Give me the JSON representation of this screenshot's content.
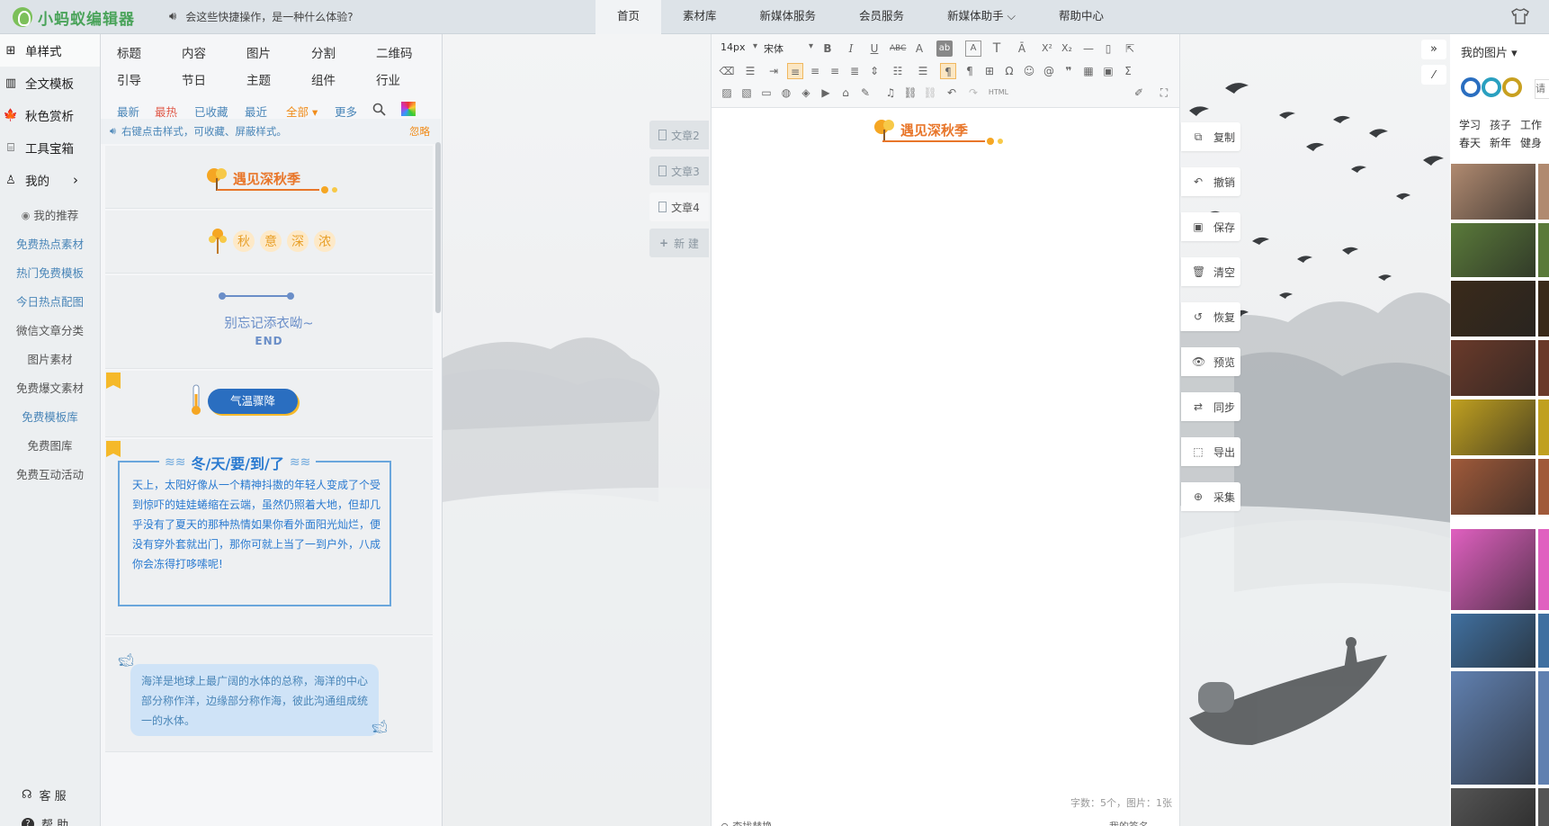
{
  "topbar": {
    "logo_text": "小蚂蚁编辑器",
    "notice": "会这些快捷操作，是一种什么体验?",
    "nav": [
      {
        "label": "首页",
        "active": true
      },
      {
        "label": "素材库"
      },
      {
        "label": "新媒体服务"
      },
      {
        "label": "会员服务"
      },
      {
        "label": "新媒体助手 ⌵"
      },
      {
        "label": "帮助中心"
      }
    ]
  },
  "sidebar": {
    "main": [
      {
        "label": "单样式",
        "icon": "grid-icon",
        "glyph": "⊞"
      },
      {
        "label": "全文模板",
        "icon": "template-icon",
        "glyph": "▥"
      },
      {
        "label": "秋色赏析",
        "icon": "maple-leaf-icon",
        "glyph": "🍁"
      },
      {
        "label": "工具宝箱",
        "icon": "toolbox-icon",
        "glyph": "⌸"
      },
      {
        "label": "我的",
        "icon": "user-icon",
        "glyph": "♙",
        "chevron": "›"
      }
    ],
    "sub": [
      {
        "label": "我的推荐",
        "icon": "eye-icon"
      },
      {
        "label": "免费热点素材",
        "link": true
      },
      {
        "label": "热门免费模板",
        "link": true
      },
      {
        "label": "今日热点配图",
        "link": true
      },
      {
        "label": "微信文章分类"
      },
      {
        "label": "图片素材"
      },
      {
        "label": "免费爆文素材"
      },
      {
        "label": "免费模板库",
        "link": true
      },
      {
        "label": "免费图库"
      },
      {
        "label": "免费互动活动"
      }
    ],
    "service": "客 服",
    "help": "帮 助"
  },
  "style_panel": {
    "categories_row1": [
      "标题",
      "内容",
      "图片",
      "分割",
      "二维码"
    ],
    "categories_row2": [
      "引导",
      "节日",
      "主题",
      "组件",
      "行业"
    ],
    "filters": [
      {
        "label": "最新",
        "color": "#4a86b8"
      },
      {
        "label": "最热",
        "color": "#e05a4a"
      },
      {
        "label": "已收藏",
        "color": "#4a86b8"
      },
      {
        "label": "最近",
        "color": "#4a86b8"
      },
      {
        "label": "全部 ▾",
        "color": "#f08c1a"
      },
      {
        "label": "更多",
        "color": "#4a86b8"
      }
    ],
    "tip": "右键点击样式，可收藏、屏蔽样式。",
    "tip_ignore": "忽略",
    "cards": {
      "autumn_title": "遇见深秋季",
      "autumn_chars": [
        "秋",
        "意",
        "深",
        "浓"
      ],
      "remember": "别忘记添衣呦~",
      "end": "END",
      "temp_button": "气温骤降",
      "winter_title": "冬/天/要/到/了",
      "winter_body": "天上，太阳好像从一个精神抖擞的年轻人变成了个受到惊吓的娃娃蜷缩在云端，虽然仍照着大地，但却几乎没有了夏天的那种热情如果你看外面阳光灿烂，便没有穿外套就出门，那你可就上当了一到户外，八成你会冻得打哆嗦呢!",
      "ocean_body": "海洋是地球上最广阔的水体的总称，海洋的中心部分称作洋，边缘部分称作海，彼此沟通组成统一的水体。"
    }
  },
  "article_tabs": [
    {
      "label": "文章2"
    },
    {
      "label": "文章3"
    },
    {
      "label": "文章4",
      "active": true
    },
    {
      "label": "新 建"
    }
  ],
  "editor": {
    "font_size": "14px",
    "font_family": "宋体",
    "content_title": "遇见深秋季",
    "status": "字数：5个，图片：1张",
    "footer_left": "查找替换",
    "footer_right": "我的签名"
  },
  "right_tools": [
    {
      "label": "复制",
      "icon": "copy-icon",
      "glyph": "⧉"
    },
    {
      "label": "撤销",
      "icon": "undo-icon",
      "glyph": "↶"
    },
    {
      "label": "保存",
      "icon": "save-icon",
      "glyph": "▣"
    },
    {
      "label": "清空",
      "icon": "trash-icon",
      "glyph": "🗑"
    },
    {
      "label": "恢复",
      "icon": "restore-icon",
      "glyph": "↺"
    },
    {
      "label": "预览",
      "icon": "eye-icon",
      "glyph": "👁"
    },
    {
      "label": "同步",
      "icon": "sync-icon",
      "glyph": "⇄"
    },
    {
      "label": "导出",
      "icon": "export-icon",
      "glyph": "⬚"
    },
    {
      "label": "采集",
      "icon": "zoom-icon",
      "glyph": "⊕"
    }
  ],
  "image_panel": {
    "title": "我的图片 ▾",
    "search_placeholder": "请",
    "tags_row1": [
      "学习",
      "孩子",
      "工作"
    ],
    "tags_row2": [
      "春天",
      "新年",
      "健身"
    ],
    "thumbnails": [
      {
        "name": "donkey-thumb",
        "color": "#b08a70"
      },
      {
        "name": "red-flower-thumb",
        "color": "#5a7a3a"
      },
      {
        "name": "orange-flowers-thumb",
        "color": "#3a2a1a"
      },
      {
        "name": "sunset-tree-thumb",
        "color": "#6a3a2a"
      },
      {
        "name": "daffodil-thumb",
        "color": "#c0a020"
      },
      {
        "name": "bread-thumb",
        "color": "#a05a3a"
      },
      {
        "name": "pink-pattern-thumb",
        "color": "#e060c0"
      },
      {
        "name": "duck-thumb",
        "color": "#4070a0"
      },
      {
        "name": "red-tower-thumb",
        "color": "#6080b0"
      },
      {
        "name": "machine-thumb",
        "color": "#555"
      }
    ]
  },
  "colors": {
    "accent": "#4a86b8",
    "orange": "#f08c1a",
    "brand_green": "#4aa35a",
    "blue_frame": "#6aa6dc"
  }
}
